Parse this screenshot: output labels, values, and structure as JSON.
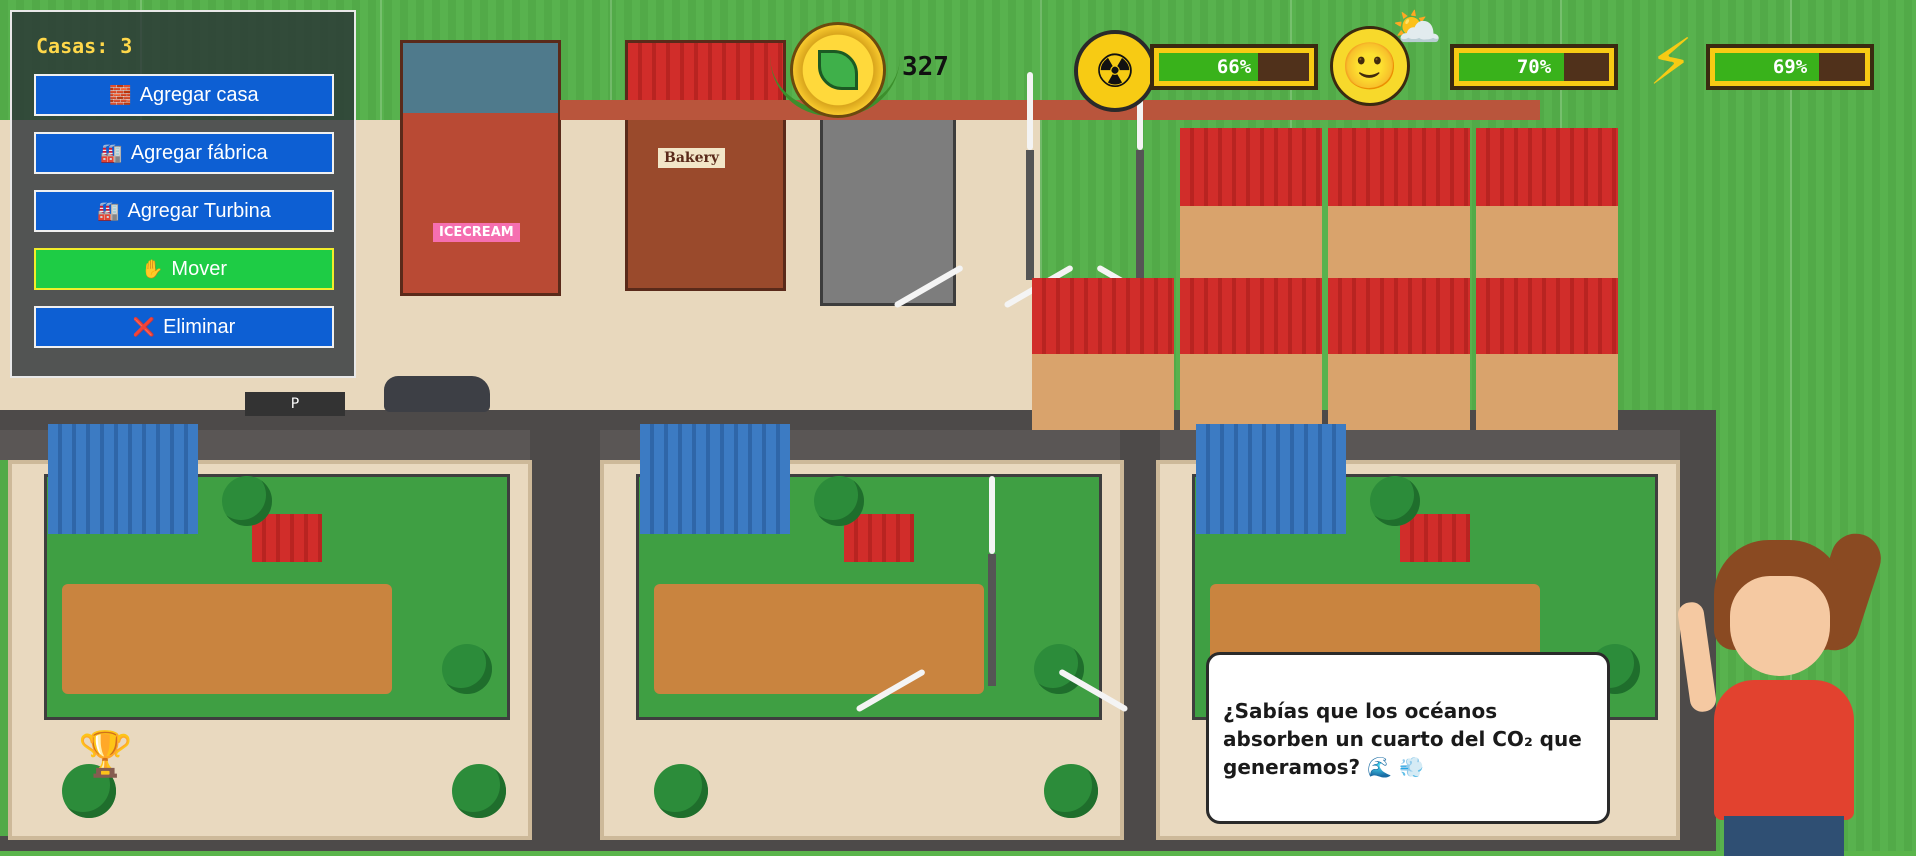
{
  "panel": {
    "casas_label": "Casas: 3",
    "buttons": [
      {
        "icon": "🧱",
        "label": "Agregar casa"
      },
      {
        "icon": "🏭",
        "label": "Agregar fábrica"
      },
      {
        "icon": "🏭",
        "label": "Agregar Turbina"
      },
      {
        "icon": "✋",
        "label": "Mover"
      },
      {
        "icon": "❌",
        "label": "Eliminar"
      }
    ]
  },
  "hud": {
    "coins": "327",
    "pollution": {
      "icon": "☢",
      "value": 66,
      "label": "66%"
    },
    "happiness": {
      "icon": "🙂",
      "value": 70,
      "label": "70%"
    },
    "energy": {
      "icon": "⚡",
      "value": 69,
      "label": "69%"
    }
  },
  "scene": {
    "signs": {
      "bakery": "Bakery",
      "icecream": "ICECREAM",
      "parking": "P"
    }
  },
  "tip": {
    "text": "¿Sabías que los océanos absorben un cuarto del CO₂ que generamos? 🌊 💨"
  },
  "trophy_icon": "🏆",
  "colors": {
    "button_blue": "#0d5fd3",
    "button_green": "#1ecc45",
    "bar_fill": "#39b21b",
    "bar_frame": "#f7cb14",
    "casas_text": "#ffd84a"
  }
}
